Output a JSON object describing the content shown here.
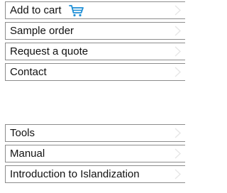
{
  "menu": {
    "group_one": [
      {
        "label": "Add to cart",
        "icon": "shopping-cart-icon"
      },
      {
        "label": "Sample order"
      },
      {
        "label": "Request a quote"
      },
      {
        "label": "Contact"
      }
    ],
    "group_two": [
      {
        "label": "Tools"
      },
      {
        "label": "Manual"
      },
      {
        "label": "Introduction to Islandization"
      }
    ]
  },
  "colors": {
    "border": "#8c8c8c",
    "chevron": "#e6e6e6",
    "cart_icon": "#1e8fd6",
    "text": "#111111"
  },
  "icons": {
    "row_indicator": "chevron-right-icon"
  }
}
